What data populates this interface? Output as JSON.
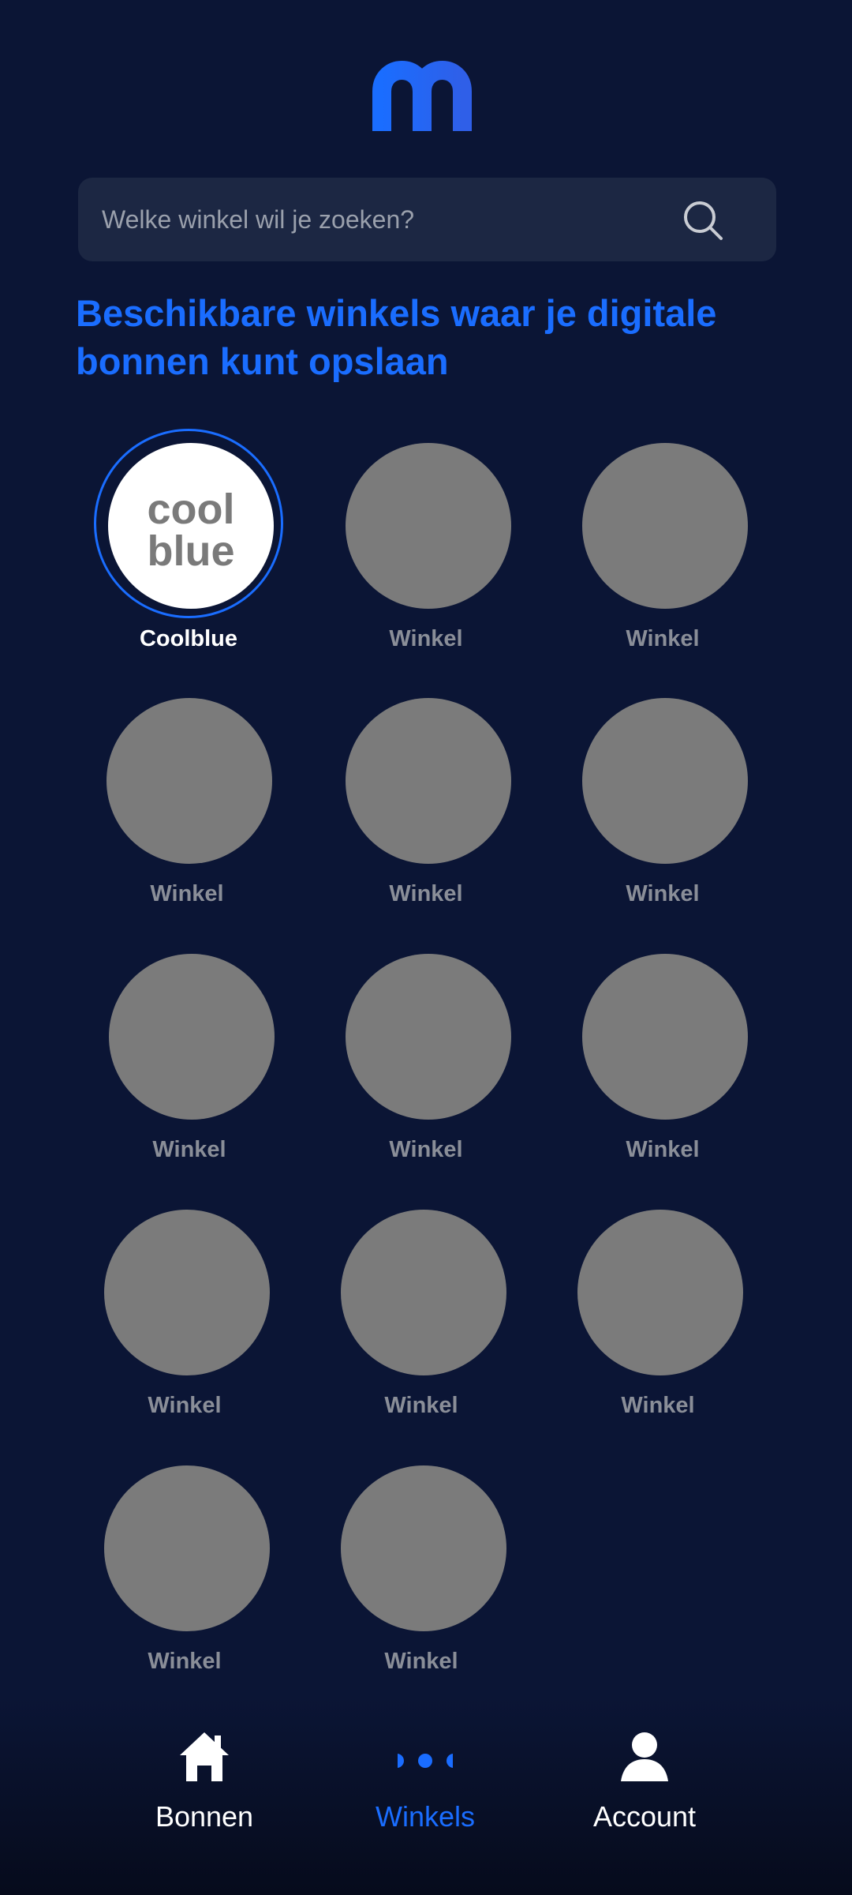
{
  "search": {
    "placeholder": "Welke winkel wil je zoeken?",
    "icon": "search-icon"
  },
  "heading": "Beschikbare winkels waar je digitale bonnen kunt opslaan",
  "stores": [
    {
      "label": "Coolblue",
      "selected": true,
      "logo_text_1": "cool",
      "logo_text_2": "blue"
    },
    {
      "label": "Winkel"
    },
    {
      "label": "Winkel"
    },
    {
      "label": "Winkel"
    },
    {
      "label": "Winkel"
    },
    {
      "label": "Winkel"
    },
    {
      "label": "Winkel"
    },
    {
      "label": "Winkel"
    },
    {
      "label": "Winkel"
    },
    {
      "label": "Winkel"
    },
    {
      "label": "Winkel"
    },
    {
      "label": "Winkel"
    },
    {
      "label": "Winkel"
    },
    {
      "label": "Winkel"
    }
  ],
  "nav": {
    "items": [
      {
        "label": "Bonnen",
        "icon": "home-icon",
        "active": false
      },
      {
        "label": "Winkels",
        "icon": "more-dots-icon",
        "active": true
      },
      {
        "label": "Account",
        "icon": "user-icon",
        "active": false
      }
    ]
  },
  "colors": {
    "background": "#0b1535",
    "accent": "#1a6dff",
    "placeholder_circle": "#7b7b7b",
    "search_bg": "#1c2743"
  }
}
